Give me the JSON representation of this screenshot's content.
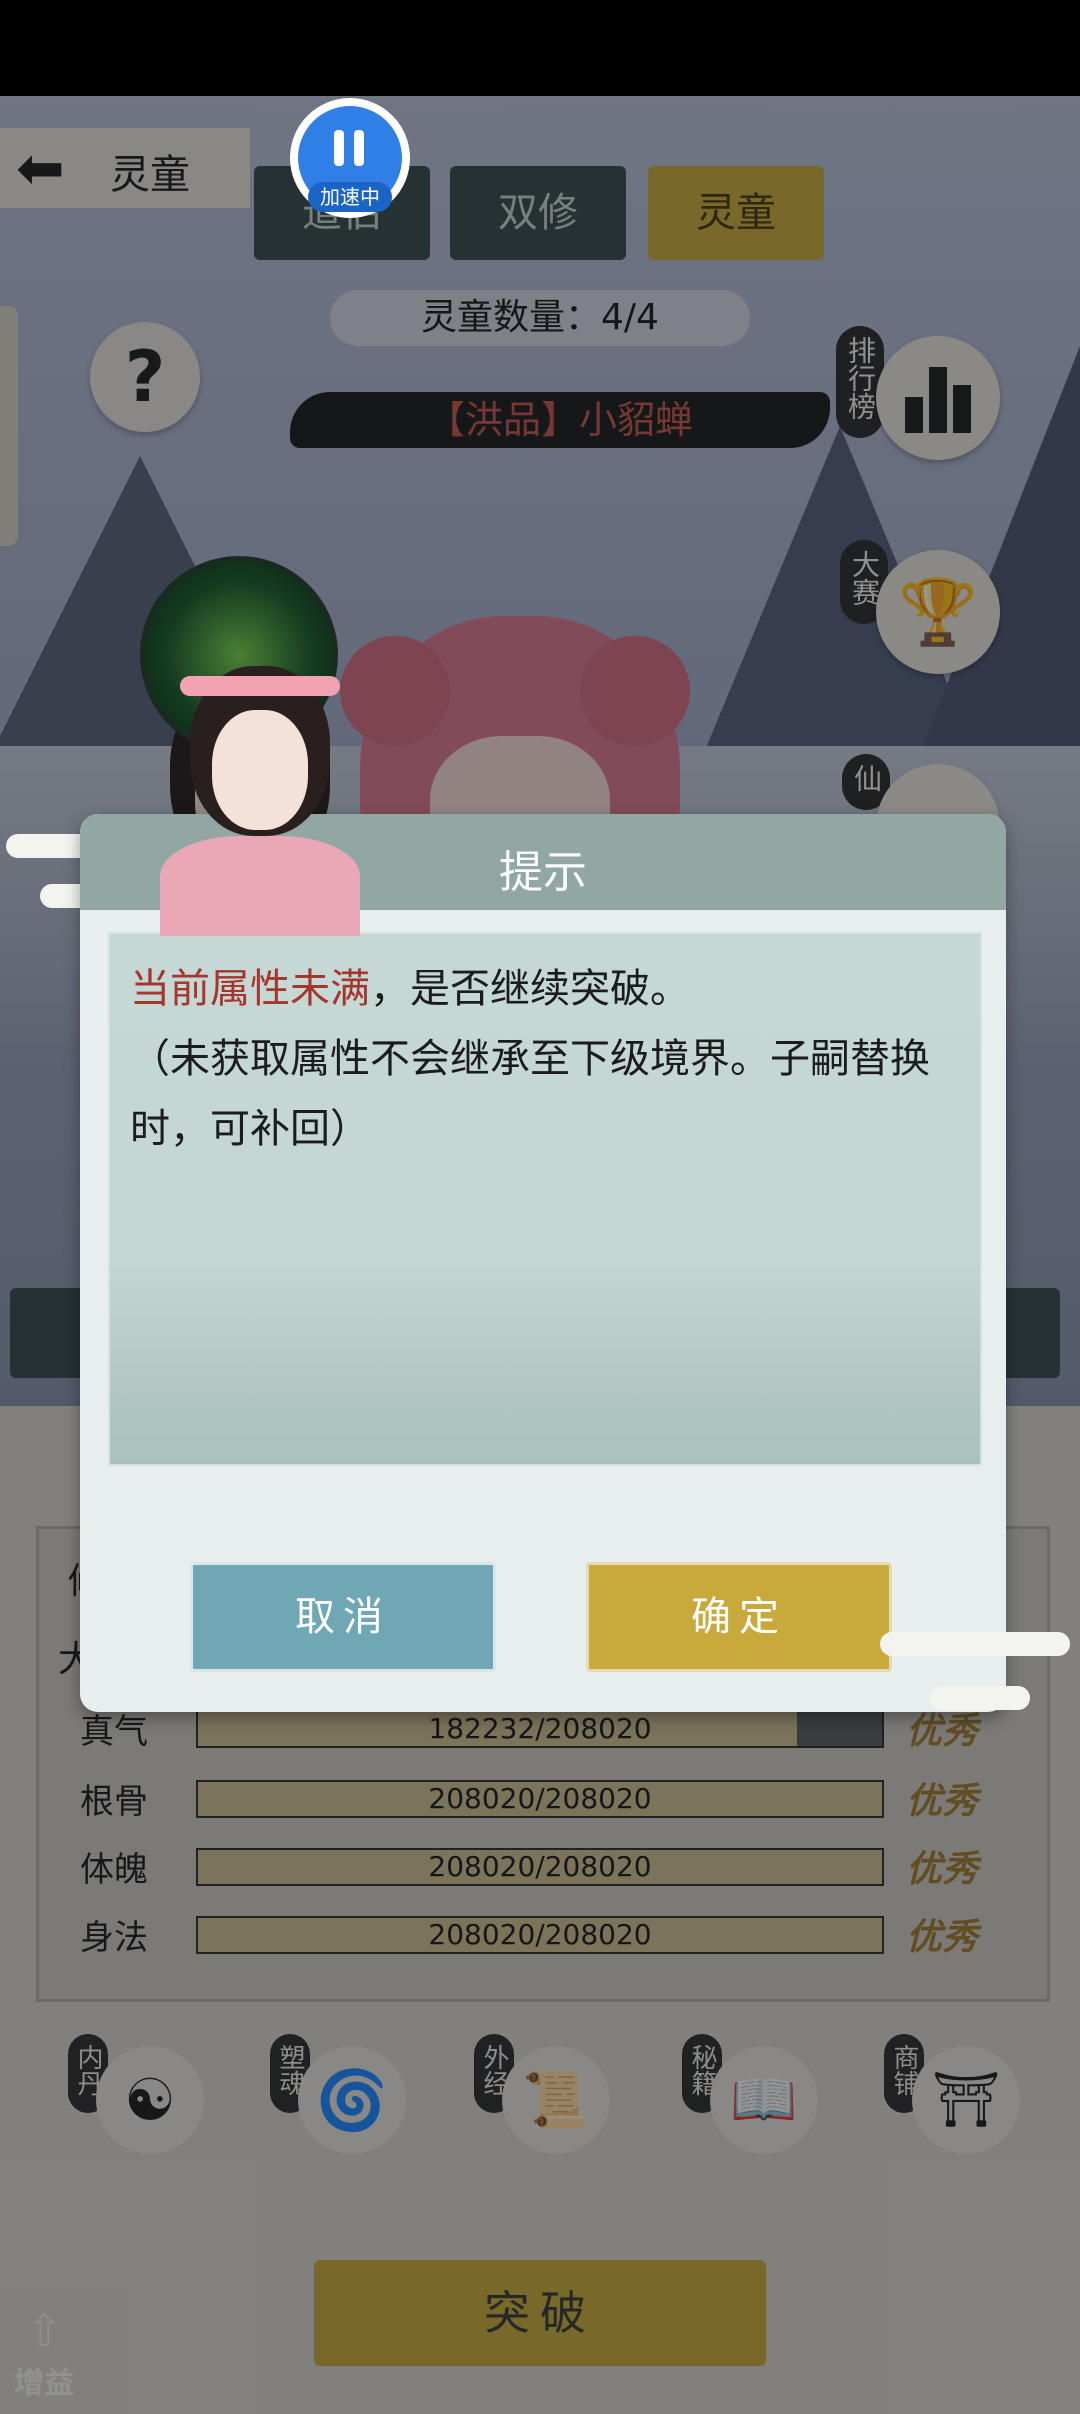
{
  "header": {
    "back_label": "灵童",
    "tabs": [
      "道侣",
      "双修",
      "灵童"
    ],
    "speed_badge": "加速中",
    "count_label": "灵童数量：4/4",
    "child_name": "【洪品】小貂蝉"
  },
  "side_menu": {
    "help_symbol": "?",
    "ranking_label": "排行榜",
    "contest_label": "大赛",
    "immortal_label": "仙"
  },
  "stats": {
    "partial_label_1": "修",
    "partial_label_2": "大",
    "rows": [
      {
        "name": "真气",
        "value": "182232/208020",
        "fill": 0.876,
        "grade": "优秀"
      },
      {
        "name": "根骨",
        "value": "208020/208020",
        "fill": 1.0,
        "grade": "优秀"
      },
      {
        "name": "体魄",
        "value": "208020/208020",
        "fill": 1.0,
        "grade": "优秀"
      },
      {
        "name": "身法",
        "value": "208020/208020",
        "fill": 1.0,
        "grade": "优秀"
      }
    ]
  },
  "bottom_nav": [
    "内丹",
    "塑魂",
    "外经",
    "秘籍",
    "商铺"
  ],
  "breakthrough_label": "突破",
  "boost_label": "增益",
  "dialog": {
    "title": "提示",
    "highlight": "当前属性未满",
    "message_rest": "，是否继续突破。",
    "note": "（未获取属性不会继承至下级境界。子嗣替换时，可补回）",
    "cancel_label": "取消",
    "confirm_label": "确定"
  },
  "colors": {
    "accent_gold": "#c9a93c",
    "cancel_blue": "#6fa7b5",
    "highlight_red": "#a5352d",
    "speed_blue": "#2f7fe6"
  }
}
